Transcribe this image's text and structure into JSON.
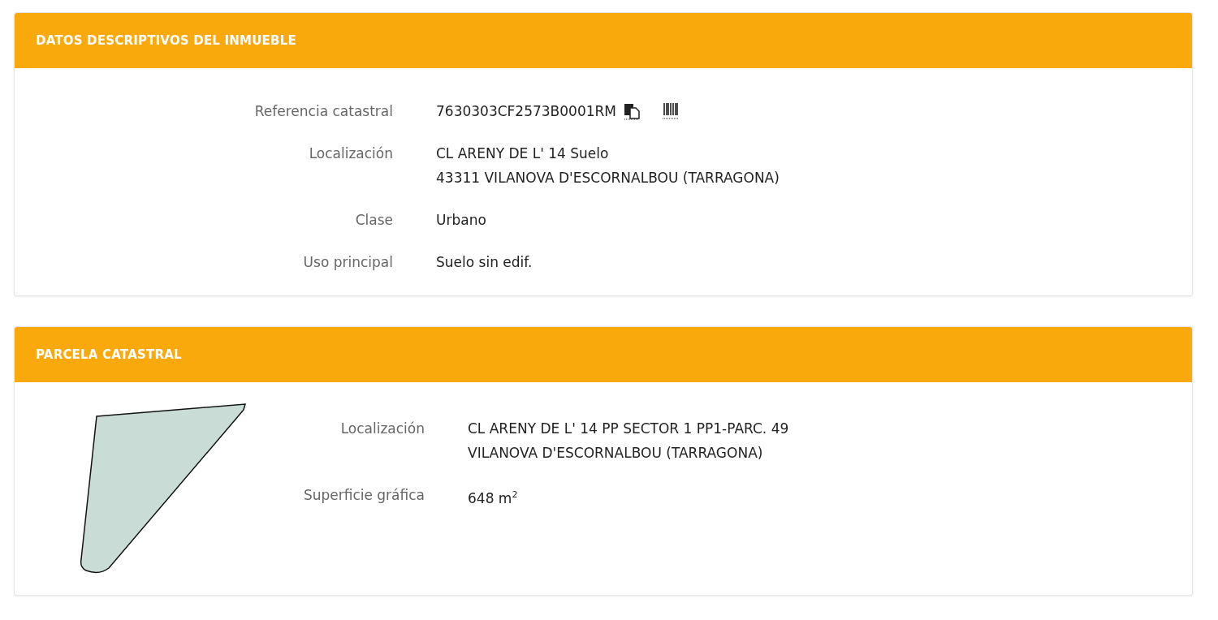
{
  "sections": [
    {
      "title": "DATOS DESCRIPTIVOS DEL INMUEBLE",
      "kind": "fields",
      "rows": [
        {
          "label": "Referencia catastral",
          "lines": [
            "7630303CF2573B0001RM"
          ],
          "actions": true
        },
        {
          "label": "Localización",
          "lines": [
            "CL ARENY DE L' 14 Suelo",
            "43311 VILANOVA D'ESCORNALBOU (TARRAGONA)"
          ]
        },
        {
          "label": "Clase",
          "lines": [
            "Urbano"
          ]
        },
        {
          "label": "Uso principal",
          "lines": [
            "Suelo sin edif."
          ]
        }
      ]
    },
    {
      "title": "PARCELA CATASTRAL",
      "kind": "parcel",
      "rows": [
        {
          "label": "Localización",
          "lines": [
            "CL ARENY DE L' 14 PP SECTOR 1 PP1-PARC. 49",
            "VILANOVA D'ESCORNALBOU (TARRAGONA)"
          ]
        },
        {
          "label": "Superficie gráfica",
          "lines": [
            "648 m$^{2}$"
          ]
        }
      ]
    }
  ]
}
